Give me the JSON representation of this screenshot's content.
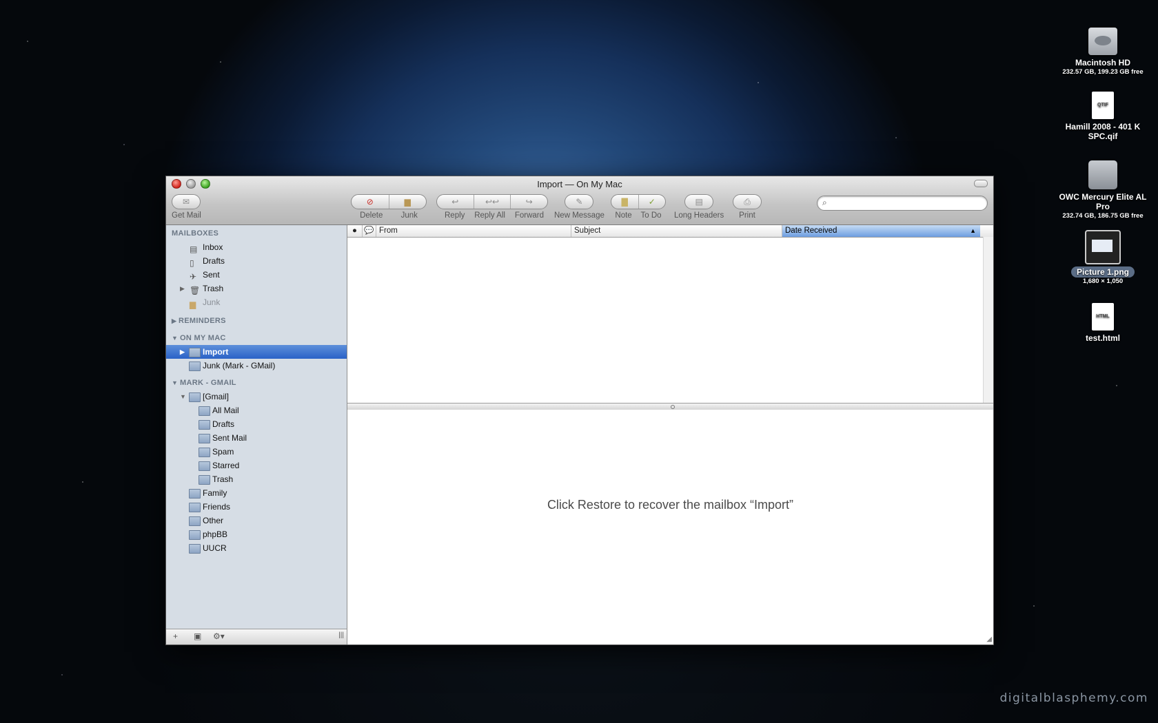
{
  "window": {
    "title": "Import — On My Mac"
  },
  "toolbar": {
    "get_mail": "Get Mail",
    "delete": "Delete",
    "junk": "Junk",
    "reply": "Reply",
    "reply_all": "Reply All",
    "forward": "Forward",
    "new_message": "New Message",
    "note": "Note",
    "todo": "To Do",
    "long_headers": "Long Headers",
    "print": "Print",
    "search_value": ""
  },
  "sidebar": {
    "mailboxes_header": "MAILBOXES",
    "mailboxes": [
      "Inbox",
      "Drafts",
      "Sent",
      "Trash",
      "Junk"
    ],
    "reminders_header": "REMINDERS",
    "onmymac_header": "ON MY MAC",
    "onmymac": [
      "Import",
      "Junk (Mark - GMail)"
    ],
    "gmail_header": "MARK - GMAIL",
    "gmail_root": "[Gmail]",
    "gmail_children": [
      "All Mail",
      "Drafts",
      "Sent Mail",
      "Spam",
      "Starred",
      "Trash"
    ],
    "gmail_folders": [
      "Family",
      "Friends",
      "Other",
      "phpBB",
      "UUCR"
    ]
  },
  "list": {
    "columns": {
      "from": "From",
      "subject": "Subject",
      "date": "Date Received"
    },
    "sort_indicator": "▲"
  },
  "preview": {
    "message": "Click Restore to recover the mailbox “Import”"
  },
  "desktop": {
    "items": [
      {
        "name": "Macintosh HD",
        "detail": "232.57 GB, 199.23 GB free"
      },
      {
        "name": "Hamill 2008 - 401 K SPC.qif",
        "detail": ""
      },
      {
        "name": "OWC Mercury Elite AL Pro",
        "detail": "232.74 GB, 186.75 GB free"
      },
      {
        "name": "Picture 1.png",
        "detail": "1,680 × 1,050"
      },
      {
        "name": "test.html",
        "detail": ""
      }
    ],
    "qif_badge": "QTIF",
    "html_badge": "HTML"
  },
  "watermark": "digitalblasphemy.com"
}
